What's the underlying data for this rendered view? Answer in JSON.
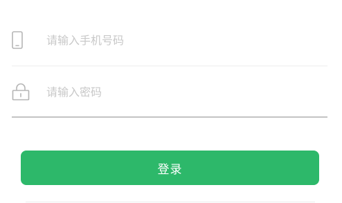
{
  "form": {
    "phone": {
      "icon": "phone-icon",
      "placeholder": "请输入手机号码",
      "value": ""
    },
    "password": {
      "icon": "lock-icon",
      "placeholder": "请输入密码",
      "value": ""
    },
    "login_label": "登录"
  },
  "colors": {
    "accent": "#2db86a",
    "placeholder": "#c8c8c8",
    "icon": "#b5b5b5",
    "divider_light": "#ececec",
    "divider_focus": "#8d8d8d"
  }
}
